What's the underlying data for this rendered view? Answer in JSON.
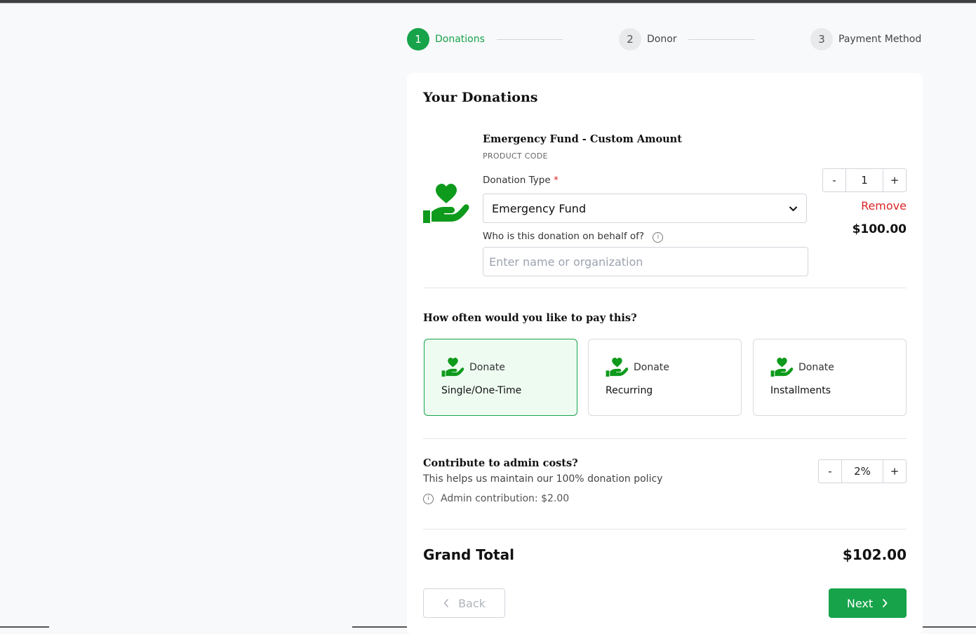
{
  "colors": {
    "accent": "#16a34a",
    "icon_green": "#0e9a1c",
    "danger": "#dc2626",
    "selected_bg": "#eefbf1"
  },
  "stepper": {
    "steps": [
      {
        "number": "1",
        "label": "Donations",
        "active": true
      },
      {
        "number": "2",
        "label": "Donor",
        "active": false
      },
      {
        "number": "3",
        "label": "Payment Method",
        "active": false
      }
    ]
  },
  "card": {
    "title": "Your Donations",
    "item": {
      "icon": "hand-heart-icon",
      "name": "Emergency Fund - Custom Amount",
      "code_label": "PRODUCT CODE",
      "donation_type_label": "Donation Type",
      "required_marker": "*",
      "donation_type_value": "Emergency Fund",
      "behalf_label": "Who is this donation on behalf of?",
      "behalf_placeholder": "Enter name or organization",
      "behalf_value": "",
      "quantity": "1",
      "decrement_label": "-",
      "increment_label": "+",
      "remove_label": "Remove",
      "price": "$100.00"
    },
    "frequency": {
      "question": "How often would you like to pay this?",
      "options": [
        {
          "kind": "Donate",
          "name": "Single/One-Time",
          "selected": true
        },
        {
          "kind": "Donate",
          "name": "Recurring",
          "selected": false
        },
        {
          "kind": "Donate",
          "name": "Installments",
          "selected": false
        }
      ]
    },
    "admin": {
      "title": "Contribute to admin costs?",
      "description": "This helps us maintain our 100% donation policy",
      "contribution_text": "Admin contribution: $2.00",
      "percent": "2%",
      "decrement_label": "-",
      "increment_label": "+"
    },
    "total": {
      "label": "Grand Total",
      "value": "$102.00"
    },
    "actions": {
      "back_label": "Back",
      "next_label": "Next"
    }
  }
}
